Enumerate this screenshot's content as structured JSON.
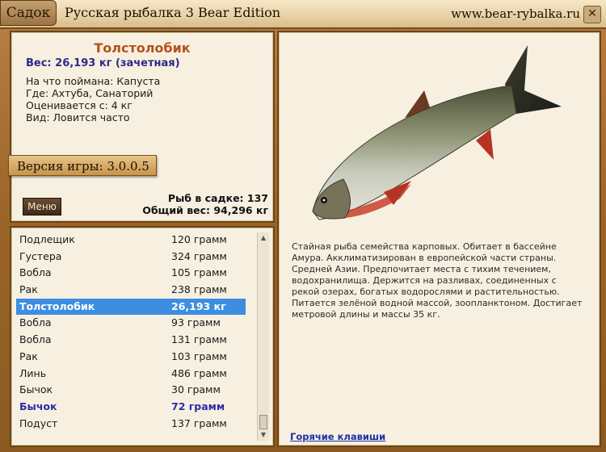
{
  "titlebar": {
    "tab_label": "Садок",
    "title": "Русская рыбалка 3 Bear Edition",
    "site": "www.bear-rybalka.ru",
    "close_label": "✕"
  },
  "info": {
    "fish_name": "Толстолобик",
    "weight": "Вес: 26,193 кг (зачетная)",
    "lines": [
      "На что поймана: Капуста",
      "Где: Ахтуба, Санаторий",
      "Оценивается с: 4 кг",
      "Вид: Ловится часто"
    ],
    "version": "Версия игры: 3.0.0.5",
    "menu_label": "Меню",
    "fish_count": "Рыб в садке: 137",
    "total_weight": "Общий вес: 94,296 кг"
  },
  "list": [
    {
      "name": "Подлещик",
      "weight": "120 грамм"
    },
    {
      "name": "Густера",
      "weight": "324 грамм"
    },
    {
      "name": "Вобла",
      "weight": "105 грамм"
    },
    {
      "name": "Рак",
      "weight": "238 грамм"
    },
    {
      "name": "Толстолобик",
      "weight": "26,193 кг",
      "selected": true
    },
    {
      "name": "Вобла",
      "weight": "93 грамм"
    },
    {
      "name": "Вобла",
      "weight": "131 грамм"
    },
    {
      "name": "Рак",
      "weight": "103 грамм"
    },
    {
      "name": "Линь",
      "weight": "486 грамм"
    },
    {
      "name": "Бычок",
      "weight": "30 грамм"
    },
    {
      "name": "Бычок",
      "weight": "72 грамм",
      "highlight": true
    },
    {
      "name": "Подуст",
      "weight": "137 грамм"
    }
  ],
  "scrollbar": {
    "up": "▲",
    "down": "▼"
  },
  "description": "Стайная рыба семейства карповых. Обитает в бассейне Амура. Акклиматизирован в европейской части страны. Средней Азии. Предпочитает места с тихим течением, водохранилища. Держится на разливах, соединенных с рекой озерах, богатых водорослями и растительностью. Питается зелёной водной массой, зоопланктоном. Достигает метровой длины и массы 35 кг.",
  "hotkeys_link": "Горячие клавиши",
  "colors": {
    "fish_name": "#b5501d",
    "weight": "#2c2a86",
    "selected_row": "#3d8ee0",
    "link": "#1b2fa8"
  },
  "icons": {
    "close": "close-icon",
    "fish": "fish-illustration"
  }
}
